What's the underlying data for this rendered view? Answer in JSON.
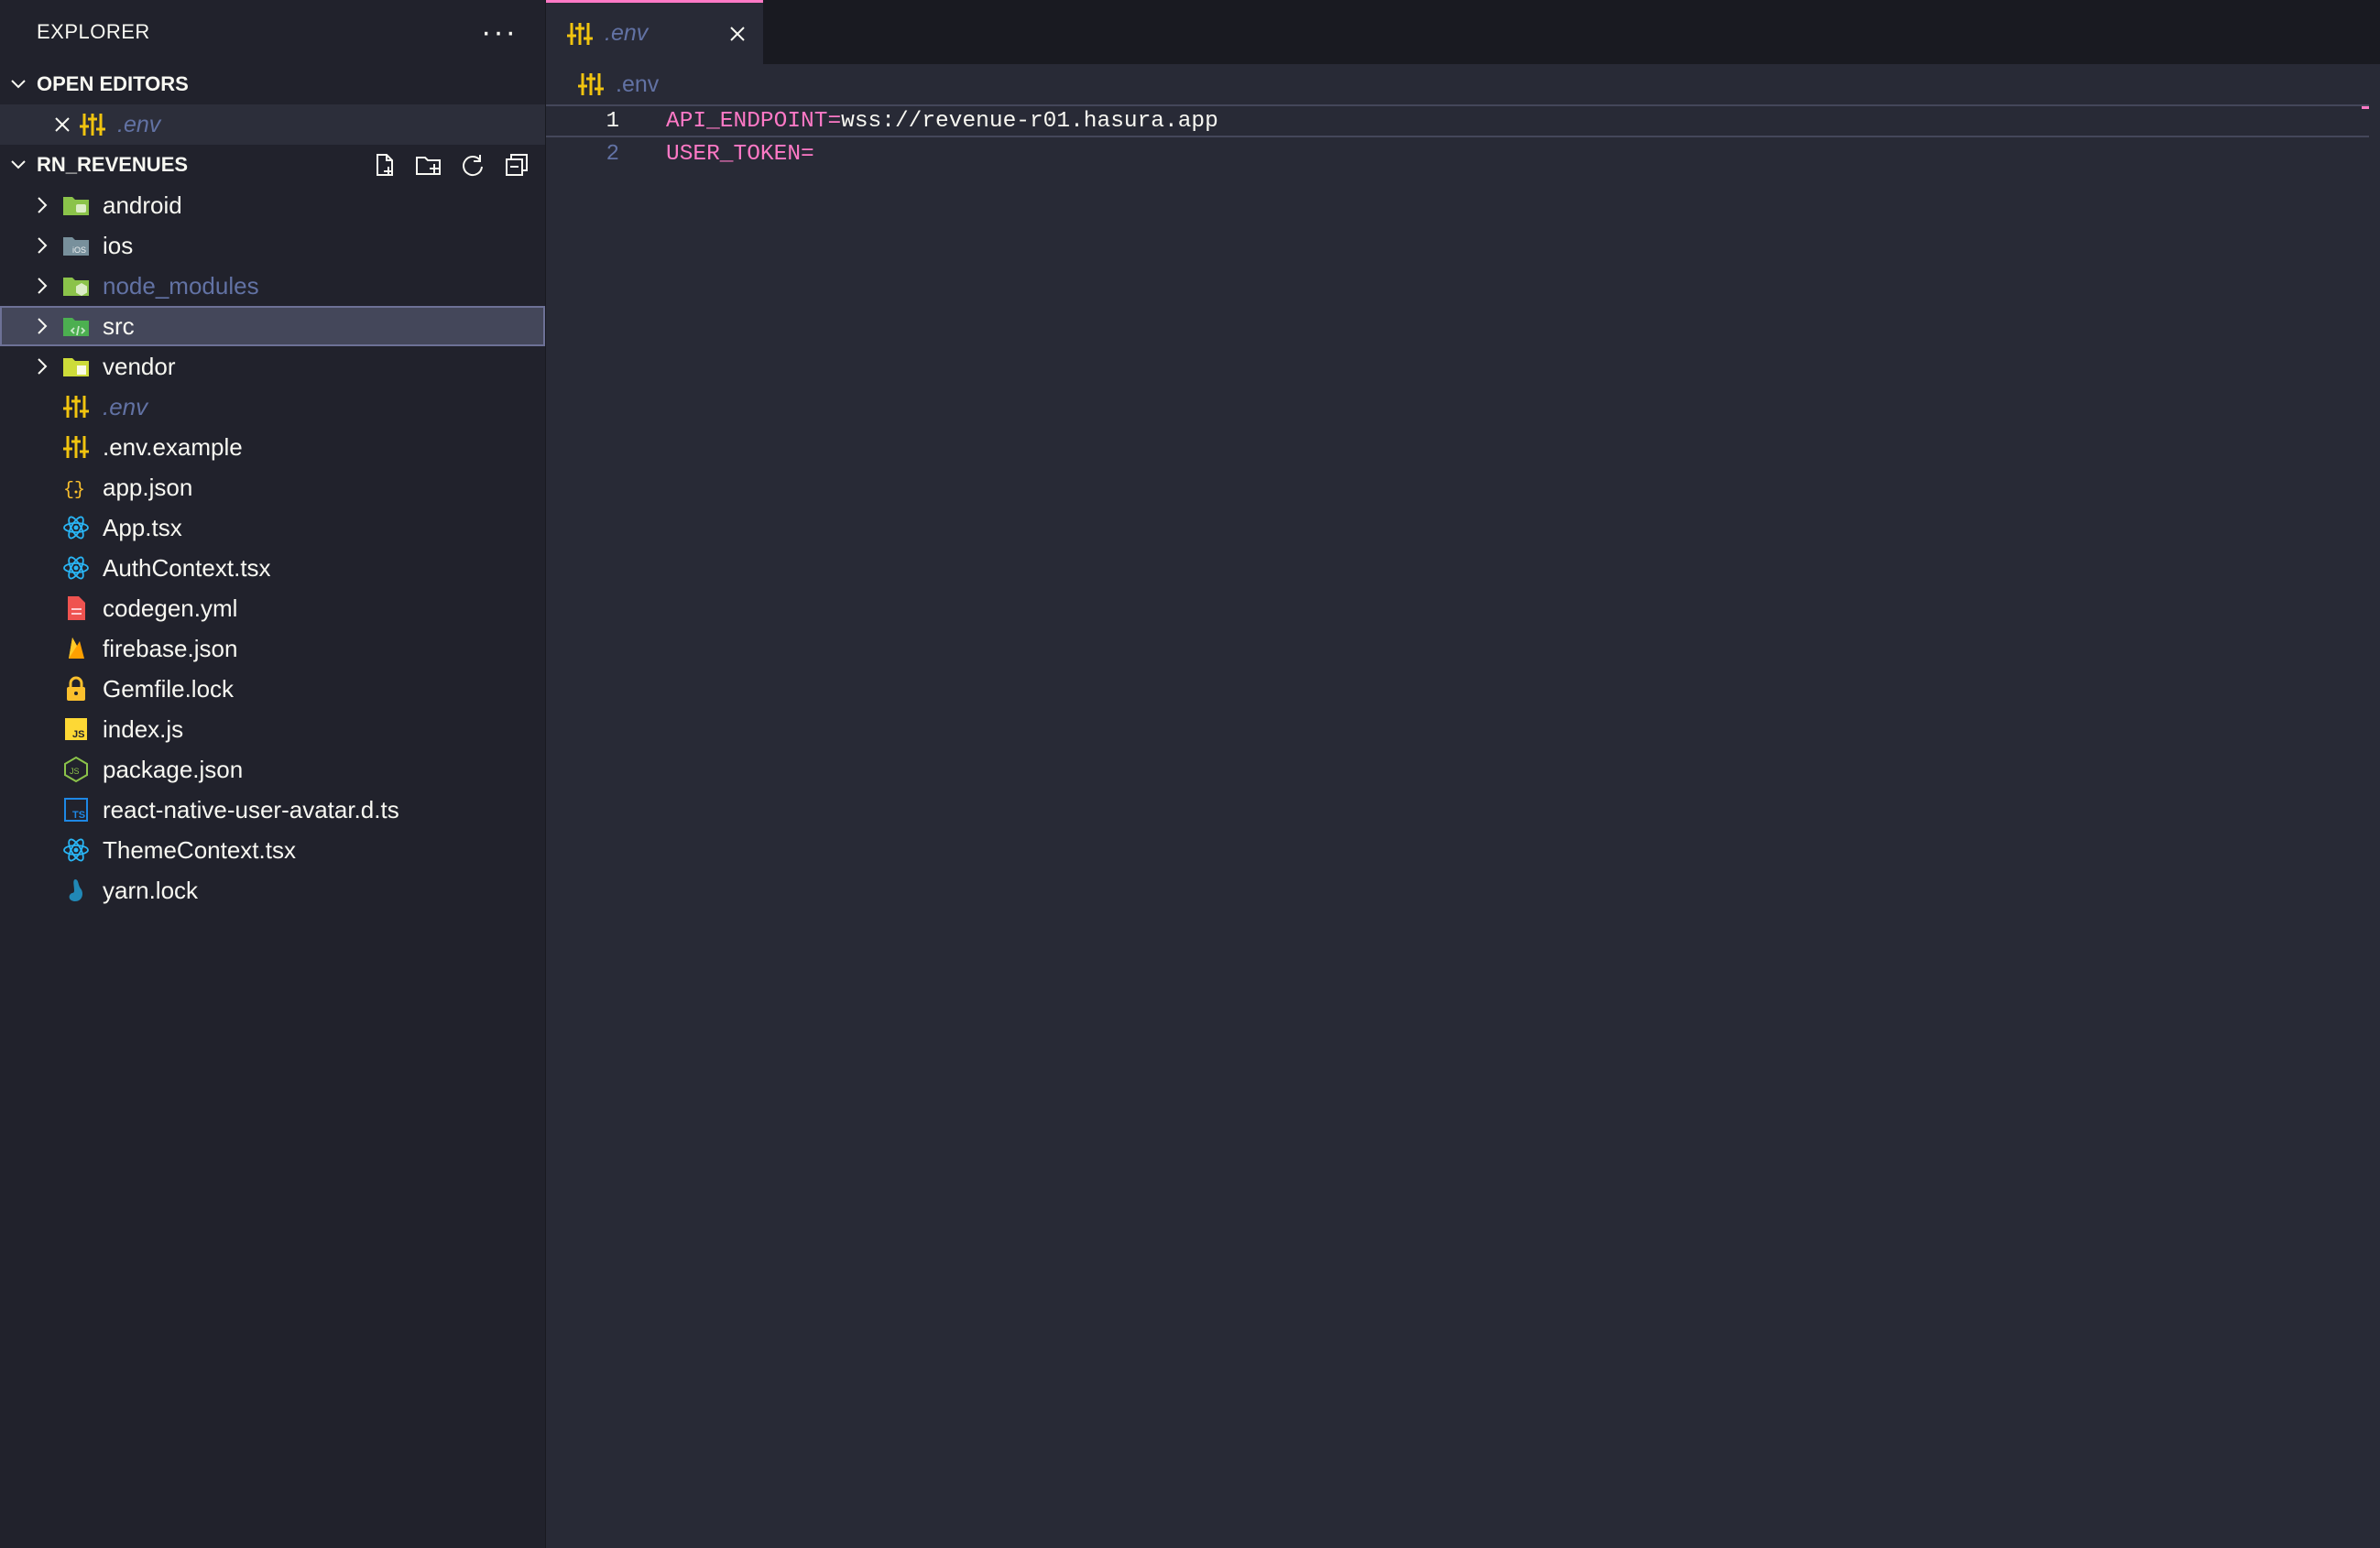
{
  "sidebar": {
    "title": "EXPLORER",
    "more_label": "···",
    "open_editors": {
      "title": "OPEN EDITORS",
      "items": [
        {
          "label": ".env",
          "icon": "env-settings-icon"
        }
      ]
    },
    "project": {
      "title": "RN_REVENUES",
      "actions": [
        "new-file-icon",
        "new-folder-icon",
        "refresh-icon",
        "collapse-all-icon"
      ],
      "items": [
        {
          "label": "android",
          "type": "folder",
          "icon": "android-folder-icon"
        },
        {
          "label": "ios",
          "type": "folder",
          "icon": "ios-folder-icon"
        },
        {
          "label": "node_modules",
          "type": "folder",
          "icon": "node-folder-icon"
        },
        {
          "label": "src",
          "type": "folder",
          "icon": "src-folder-icon"
        },
        {
          "label": "vendor",
          "type": "folder",
          "icon": "vendor-folder-icon"
        },
        {
          "label": ".env",
          "type": "file",
          "icon": "env-settings-icon"
        },
        {
          "label": ".env.example",
          "type": "file",
          "icon": "env-settings-icon"
        },
        {
          "label": "app.json",
          "type": "file",
          "icon": "json-icon"
        },
        {
          "label": "App.tsx",
          "type": "file",
          "icon": "react-icon"
        },
        {
          "label": "AuthContext.tsx",
          "type": "file",
          "icon": "react-icon"
        },
        {
          "label": "codegen.yml",
          "type": "file",
          "icon": "yaml-icon"
        },
        {
          "label": "firebase.json",
          "type": "file",
          "icon": "firebase-icon"
        },
        {
          "label": "Gemfile.lock",
          "type": "file",
          "icon": "lock-icon"
        },
        {
          "label": "index.js",
          "type": "file",
          "icon": "javascript-icon"
        },
        {
          "label": "package.json",
          "type": "file",
          "icon": "nodejs-icon"
        },
        {
          "label": "react-native-user-avatar.d.ts",
          "type": "file",
          "icon": "typescript-icon"
        },
        {
          "label": "ThemeContext.tsx",
          "type": "file",
          "icon": "react-icon"
        },
        {
          "label": "yarn.lock",
          "type": "file",
          "icon": "yarn-icon"
        }
      ]
    }
  },
  "editor": {
    "tab": {
      "label": ".env",
      "icon": "env-settings-icon"
    },
    "breadcrumb": {
      "label": ".env"
    },
    "lines": [
      {
        "number": "1",
        "key": "API_ENDPOINT",
        "eq": "=",
        "value": "wss://revenue-r01.hasura.app"
      },
      {
        "number": "2",
        "key": "USER_TOKEN",
        "eq": "=",
        "value": ""
      }
    ]
  },
  "colors": {
    "background": "#282a36",
    "sidebar": "#21222c",
    "accent": "#ff79c6",
    "comment": "#6272a4",
    "selection": "#44475a"
  }
}
